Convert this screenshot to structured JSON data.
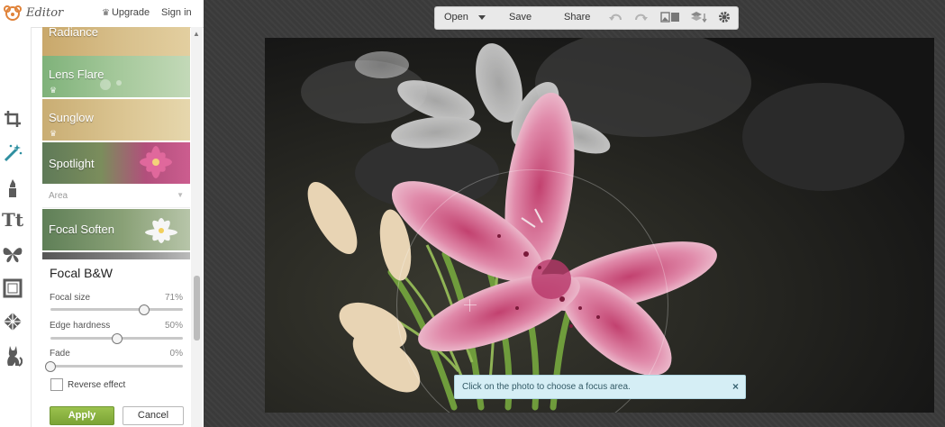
{
  "header": {
    "app_name": "Editor",
    "upgrade_label": "Upgrade",
    "signin_label": "Sign in"
  },
  "tools": [
    {
      "icon": "crop-icon"
    },
    {
      "icon": "effects-wand-icon"
    },
    {
      "icon": "touch-up-lipstick-icon"
    },
    {
      "icon": "text-icon",
      "glyph": "Tt"
    },
    {
      "icon": "overlays-butterfly-icon"
    },
    {
      "icon": "frames-icon"
    },
    {
      "icon": "textures-icon"
    },
    {
      "icon": "seasonal-cat-icon"
    }
  ],
  "effects": {
    "items": [
      {
        "label": "Radiance",
        "premium": false
      },
      {
        "label": "Lens Flare",
        "premium": true
      },
      {
        "label": "Sunglow",
        "premium": true
      },
      {
        "label": "Spotlight",
        "premium": false
      },
      {
        "label": "Focal Soften",
        "premium": false
      }
    ],
    "area_header": "Area"
  },
  "panel": {
    "title": "Focal B&W",
    "sliders": [
      {
        "label": "Focal size",
        "value": "71%",
        "fraction": 0.71
      },
      {
        "label": "Edge hardness",
        "value": "50%",
        "fraction": 0.5
      },
      {
        "label": "Fade",
        "value": "0%",
        "fraction": 0.0
      }
    ],
    "reverse_label": "Reverse effect",
    "reverse_checked": false,
    "apply_label": "Apply",
    "cancel_label": "Cancel"
  },
  "toolbar": {
    "open_label": "Open",
    "save_label": "Save",
    "share_label": "Share"
  },
  "hint": {
    "text": "Click on the photo to choose a focus area.",
    "close": "×"
  },
  "colors": {
    "accent_green": "#8bb642",
    "hint_bg": "#d5eef5",
    "canvas_bg": "#3a3a3a"
  }
}
